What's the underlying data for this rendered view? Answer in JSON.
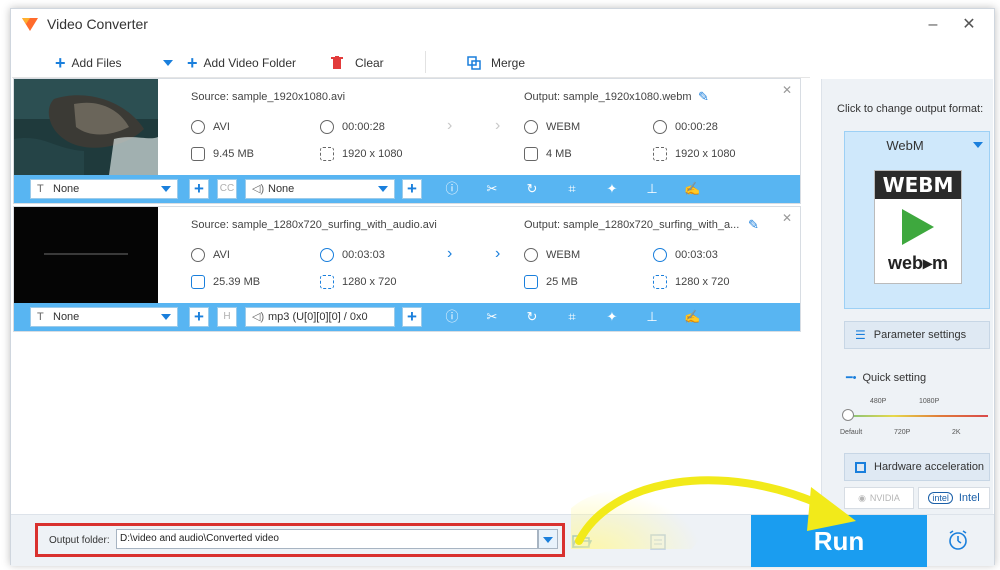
{
  "window": {
    "title": "Video Converter",
    "accent": "#1a7fdc",
    "strip_color": "#58b5f2"
  },
  "toolbar": {
    "add_files": "Add Files",
    "add_folder": "Add Video Folder",
    "clear": "Clear",
    "merge": "Merge"
  },
  "files": [
    {
      "source": "Source: sample_1920x1080.avi",
      "src_format": "AVI",
      "src_duration": "00:00:28",
      "src_size": "9.45 MB",
      "src_resolution": "1920 x 1080",
      "output": "Output: sample_1920x1080.webm",
      "out_format": "WEBM",
      "out_duration": "00:00:28",
      "out_size": "4 MB",
      "out_resolution": "1920 x 1080",
      "subtitle": "None",
      "audio": "None"
    },
    {
      "source": "Source: sample_1280x720_surfing_with_audio.avi",
      "src_format": "AVI",
      "src_duration": "00:03:03",
      "src_size": "25.39 MB",
      "src_resolution": "1280 x 720",
      "output": "Output: sample_1280x720_surfing_with_a...",
      "out_format": "WEBM",
      "out_duration": "00:03:03",
      "out_size": "25 MB",
      "out_resolution": "1280 x 720",
      "subtitle": "None",
      "audio": "mp3 (U[0][0][0] / 0x0"
    }
  ],
  "panel": {
    "change_format": "Click to change output format:",
    "format": "WebM",
    "logo_top": "WEBM",
    "logo_bottom": "web▸m",
    "param_settings": "Parameter settings",
    "quick_setting": "Quick setting",
    "q_480": "480P",
    "q_1080": "1080P",
    "q_default": "Default",
    "q_720": "720P",
    "q_2k": "2K",
    "hw_accel": "Hardware acceleration",
    "nvidia": "NVIDIA",
    "intel_logo": "intel",
    "intel": "Intel"
  },
  "bottom": {
    "output_label": "Output folder:",
    "output_path": "D:\\video and audio\\Converted video",
    "run": "Run"
  }
}
